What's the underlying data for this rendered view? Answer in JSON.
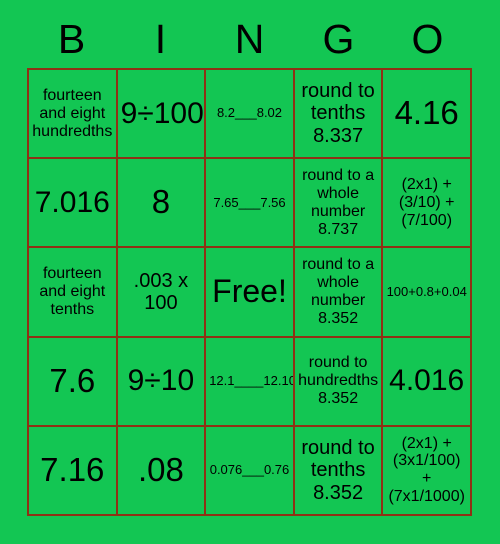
{
  "card": {
    "title_letters": [
      "B",
      "I",
      "N",
      "G",
      "O"
    ],
    "background_color": "#13c653",
    "border_color": "#8f3115",
    "text_color": "#000000",
    "rows": [
      [
        {
          "text": "fourteen\nand eight\nhundredths",
          "size": "sm"
        },
        {
          "text": "9÷100",
          "size": "lg"
        },
        {
          "text": "8.2___8.02",
          "size": "xs"
        },
        {
          "text": "round to\ntenths\n8.337",
          "size": "md"
        },
        {
          "text": "4.16",
          "size": "xl"
        }
      ],
      [
        {
          "text": "7.016",
          "size": "lg"
        },
        {
          "text": "8",
          "size": "xl"
        },
        {
          "text": "7.65___7.56",
          "size": "xs"
        },
        {
          "text": "round to a\nwhole\nnumber\n8.737",
          "size": "sm"
        },
        {
          "text": "(2x1) +\n(3/10) +\n(7/100)",
          "size": "sm"
        }
      ],
      [
        {
          "text": "fourteen\nand eight\ntenths",
          "size": "sm"
        },
        {
          "text": ".003 x\n100",
          "size": "md"
        },
        {
          "text": "Free!",
          "size": "free"
        },
        {
          "text": "round to a\nwhole\nnumber\n8.352",
          "size": "sm"
        },
        {
          "text": "100+0.8+0.04",
          "size": "xs"
        }
      ],
      [
        {
          "text": "7.6",
          "size": "xl"
        },
        {
          "text": "9÷10",
          "size": "lg"
        },
        {
          "text": "12.1____12.10",
          "size": "xs"
        },
        {
          "text": "round to\nhundredths\n8.352",
          "size": "sm"
        },
        {
          "text": "4.016",
          "size": "lg"
        }
      ],
      [
        {
          "text": "7.16",
          "size": "xl"
        },
        {
          "text": ".08",
          "size": "xl"
        },
        {
          "text": "0.076___0.76",
          "size": "xs"
        },
        {
          "text": "round to\ntenths\n8.352",
          "size": "md"
        },
        {
          "text": "(2x1) +\n(3x1/100)\n+\n(7x1/1000)",
          "size": "sm"
        }
      ]
    ]
  }
}
